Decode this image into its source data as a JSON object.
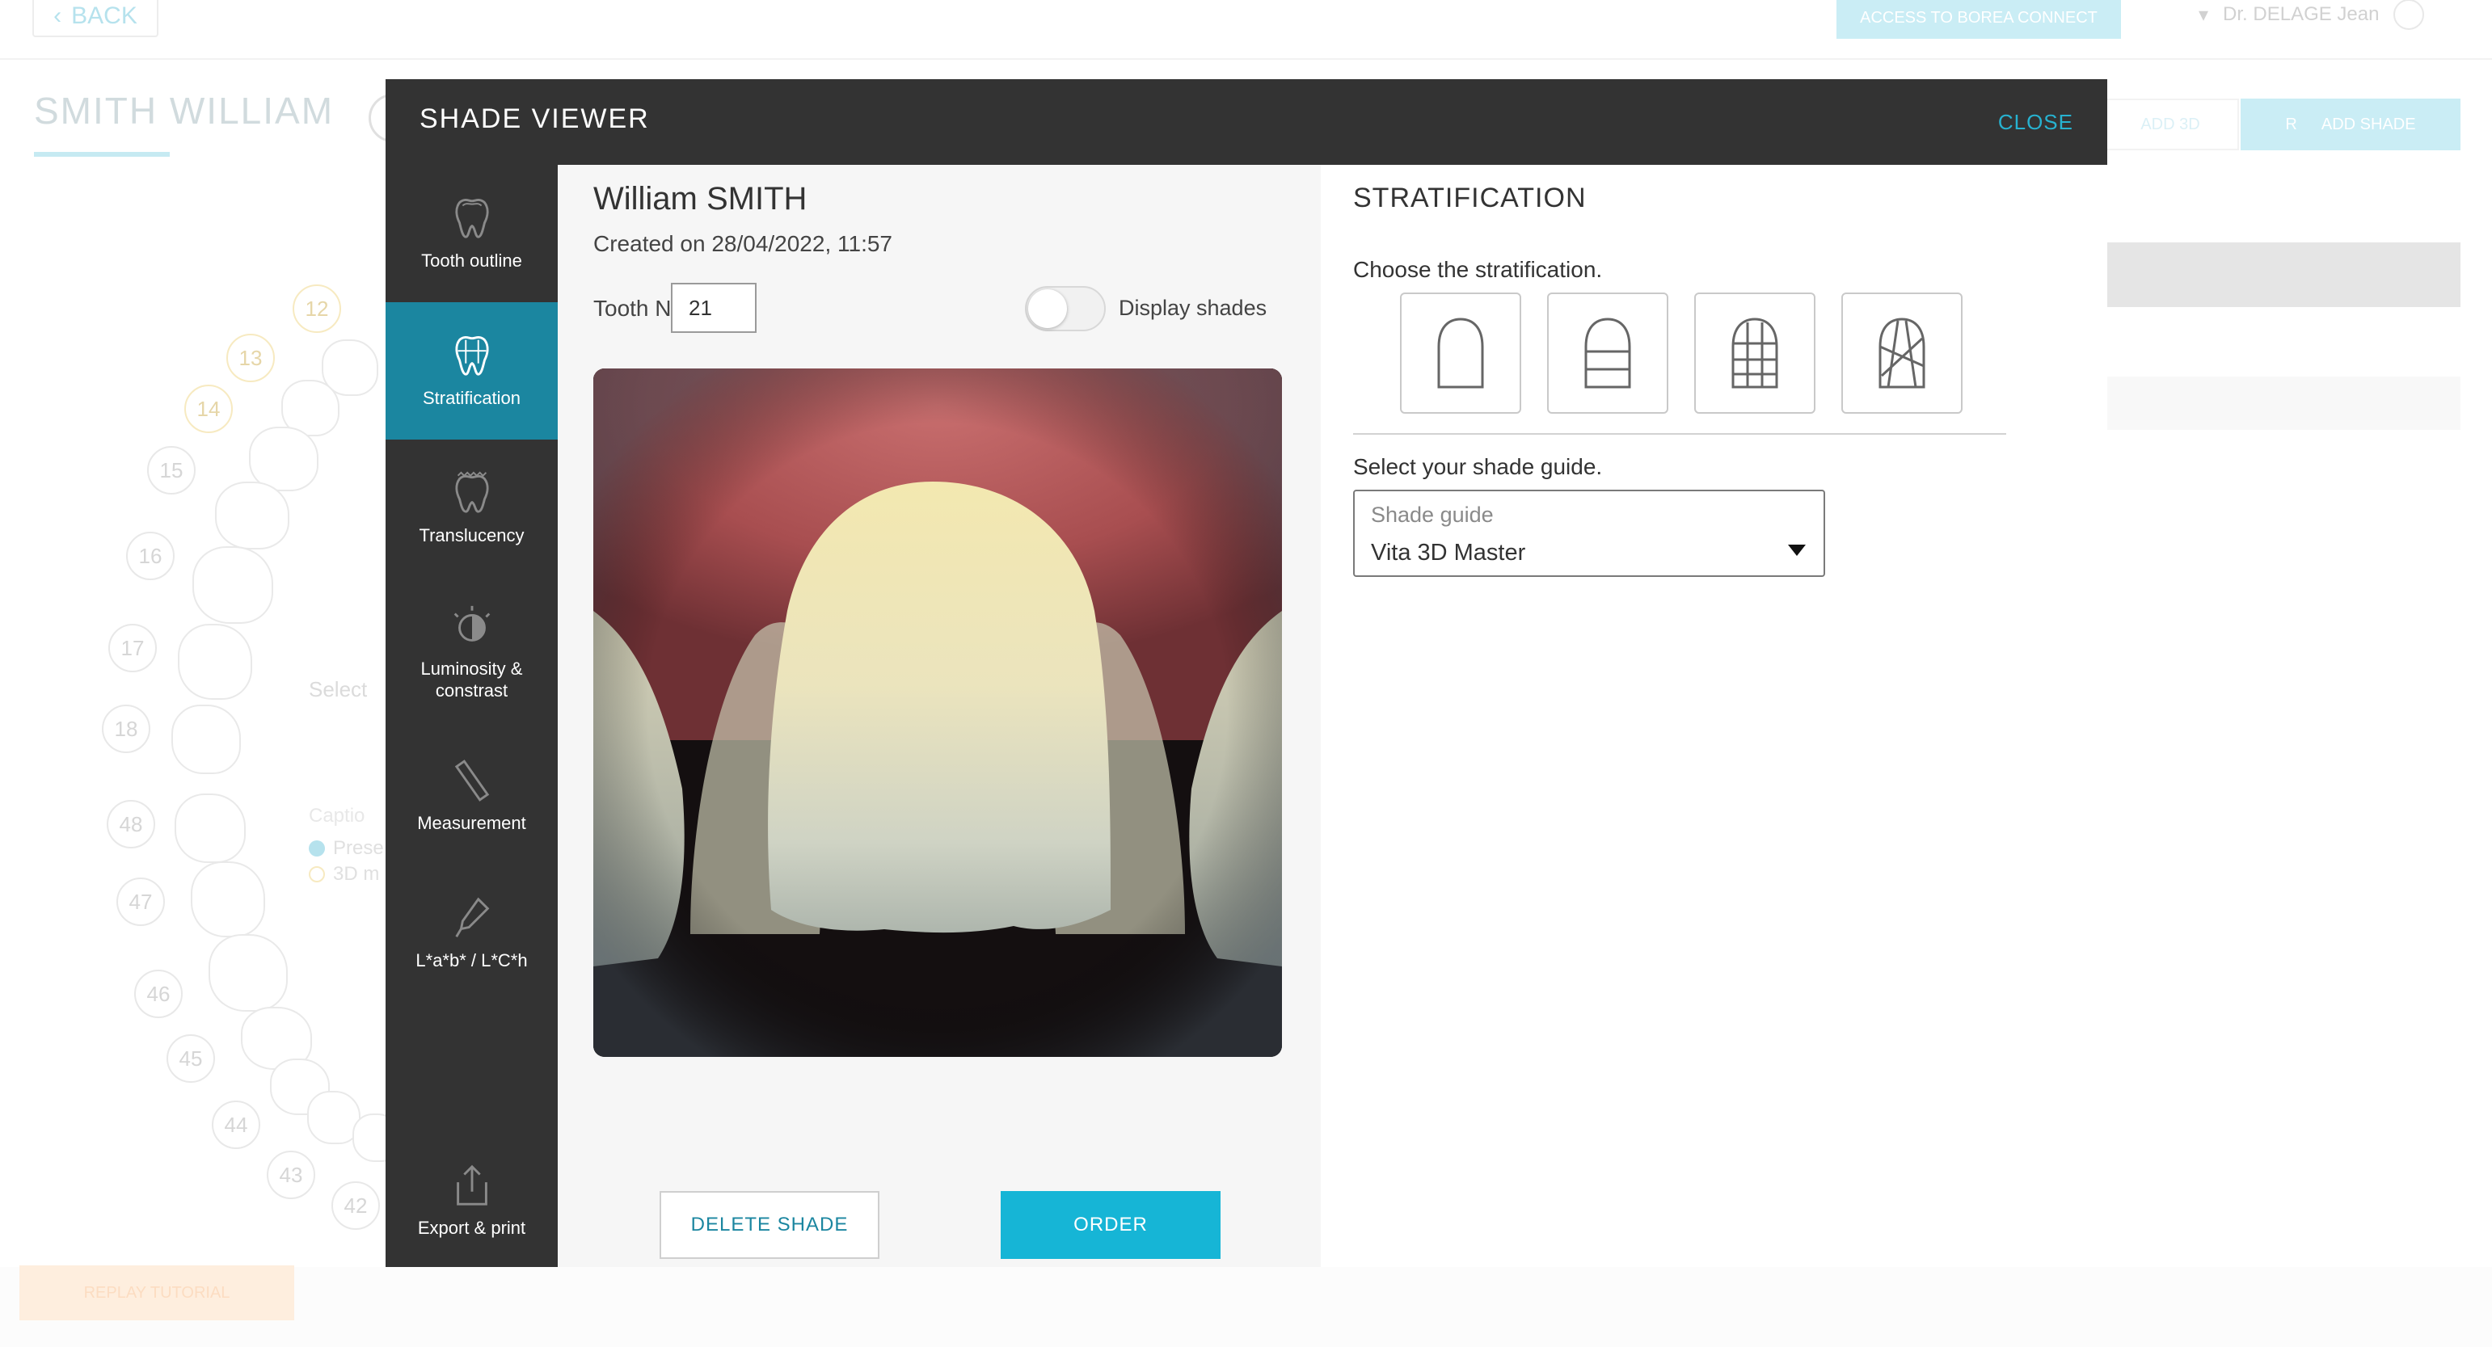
{
  "background": {
    "back_label": "BACK",
    "access_button": "ACCESS TO BOREA CONNECT",
    "user_name": "Dr. DELAGE Jean",
    "patient_name": "SMITH WILLIAM",
    "add3d_label": "ADD 3D",
    "addshade_label": "ADD SHADE",
    "select_text": "Select",
    "caption_text": "Captio",
    "legend": [
      {
        "label": "Prese",
        "color": "#8fd3e4"
      },
      {
        "label": "3D m",
        "color": "#f3dfa0"
      }
    ],
    "tooth_numbers": [
      "12",
      "13",
      "14",
      "15",
      "16",
      "17",
      "18",
      "48",
      "47",
      "46",
      "45",
      "44",
      "43",
      "42"
    ],
    "replay_label": "REPLAY TUTORIAL"
  },
  "modal": {
    "title": "SHADE VIEWER",
    "close_label": "CLOSE",
    "sidebar": [
      {
        "label": "Tooth outline",
        "icon": "tooth-outline-icon",
        "active": false
      },
      {
        "label": "Stratification",
        "icon": "stratification-icon",
        "active": true
      },
      {
        "label": "Translucency",
        "icon": "translucency-icon",
        "active": false
      },
      {
        "label": "Luminosity & constrast",
        "icon": "luminosity-icon",
        "active": false
      },
      {
        "label": "Measurement",
        "icon": "ruler-icon",
        "active": false
      },
      {
        "label": "L*a*b* / L*C*h",
        "icon": "pipette-icon",
        "active": false
      },
      {
        "label": "Export & print",
        "icon": "export-icon",
        "active": false
      }
    ],
    "patient_fullname": "William SMITH",
    "created": "Created on 28/04/2022, 11:57",
    "tooth_label": "Tooth No.",
    "tooth_value": "21",
    "display_shades_label": "Display shades",
    "display_shades_on": false,
    "delete_label": "DELETE SHADE",
    "order_label": "ORDER"
  },
  "stratification": {
    "title": "STRATIFICATION",
    "choose_label": "Choose the stratification.",
    "options": [
      "single-layer-icon",
      "two-layer-icon",
      "grid-layer-icon",
      "mamelon-layer-icon"
    ],
    "shade_guide_label": "Select your shade guide.",
    "shade_guide_placeholder": "Shade guide",
    "shade_guide_value": "Vita 3D Master"
  },
  "colors": {
    "accent": "#16b5d6",
    "sidebar_bg": "#333333",
    "active_bg": "#1b86a0"
  }
}
